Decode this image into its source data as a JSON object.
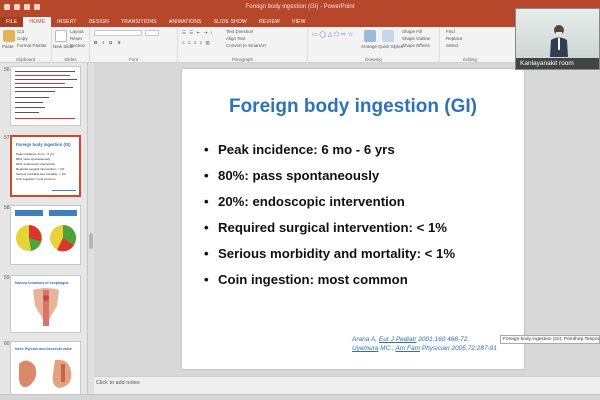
{
  "window": {
    "title": "Foreign body ingestion (GI) - PowerPoint"
  },
  "ribbon_tabs": [
    "FILE",
    "HOME",
    "INSERT",
    "DESIGN",
    "TRANSITIONS",
    "ANIMATIONS",
    "SLIDE SHOW",
    "REVIEW",
    "VIEW"
  ],
  "ribbon": {
    "clipboard": {
      "paste": "Paste",
      "cut": "Cut",
      "copy": "Copy",
      "format_painter": "Format Painter",
      "group": "Clipboard"
    },
    "slides": {
      "new_slide": "New Slide",
      "layout": "Layout",
      "reset": "Reset",
      "section": "Section",
      "group": "Slides"
    },
    "font_group": "Font",
    "paragraph": {
      "text_direction": "Text Direction",
      "align_text": "Align Text",
      "smartart": "Convert to SmartArt",
      "group": "Paragraph"
    },
    "drawing": {
      "arrange": "Arrange",
      "quick_styles": "Quick Styles",
      "shape_fill": "Shape Fill",
      "shape_outline": "Shape Outline",
      "shape_effects": "Shape Effects",
      "group": "Drawing"
    },
    "editing": {
      "find": "Find",
      "replace": "Replace",
      "select": "Select",
      "group": "Editing"
    }
  },
  "thumbnails": [
    {
      "number": "56"
    },
    {
      "number": "57",
      "title": "Foreign body ingestion (GI)",
      "bullets": [
        "Peak incidence: 6 mo - 6 yrs",
        "80%: pass spontaneously",
        "20%: endoscopic intervention",
        "Required surgical intervention: < 1%",
        "Serious morbidity and mortality: < 1%",
        "Coin ingestion: most common"
      ]
    },
    {
      "number": "58"
    },
    {
      "number": "59",
      "title": "Narrow locations of esophagus"
    },
    {
      "number": "60",
      "title": "Next: Pylorus and ileocecal valve"
    }
  ],
  "slide": {
    "title": "Foreign body ingestion (GI)",
    "bullets": [
      "Peak incidence: 6 mo - 6 yrs",
      "80%: pass spontaneously",
      "20%: endoscopic intervention",
      "Required surgical intervention: < 1%",
      "Serious morbidity and mortality: < 1%",
      "Coin ingestion: most common"
    ],
    "references": {
      "ref1_authors": "Arana A, ",
      "ref1_journal": "Eur J Pediatr",
      "ref1_rest": " 2001;160:468-72.",
      "ref2_authors": "Uyemura",
      "ref2_mid": " MC., ",
      "ref2_journal": "Am Fam",
      "ref2_rest": " Physician 2005;72:287-91"
    }
  },
  "notes_placeholder": "Click to add notes",
  "tooltip": "Foreign body ingestion (GI): Pornthep Tanpowpong MD. (",
  "video": {
    "participant": "Kanlayanakit room"
  },
  "colors": {
    "accent": "#b7472a",
    "title_blue": "#2e73b8",
    "selected_border": "#d24726"
  }
}
